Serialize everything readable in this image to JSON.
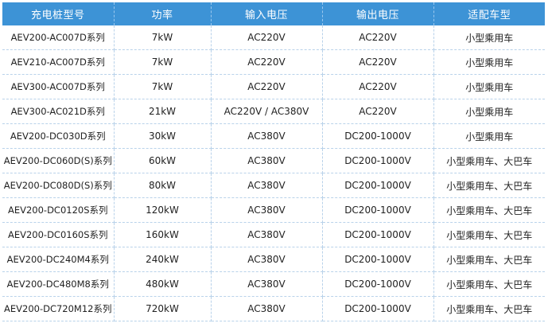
{
  "table": {
    "headers": [
      "充电桩型号",
      "功率",
      "输入电压",
      "输出电压",
      "适配车型"
    ],
    "rows": [
      [
        "AEV200-AC007D系列",
        "7kW",
        "AC220V",
        "AC220V",
        "小型乘用车"
      ],
      [
        "AEV210-AC007D系列",
        "7kW",
        "AC220V",
        "AC220V",
        "小型乘用车"
      ],
      [
        "AEV300-AC007D系列",
        "7kW",
        "AC220V",
        "AC220V",
        "小型乘用车"
      ],
      [
        "AEV300-AC021D系列",
        "21kW",
        "AC220V / AC380V",
        "AC220V",
        "小型乘用车"
      ],
      [
        "AEV200-DC030D系列",
        "30kW",
        "AC380V",
        "DC200-1000V",
        "小型乘用车"
      ],
      [
        "AEV200-DC060D(S)系列",
        "60kW",
        "AC380V",
        "DC200-1000V",
        "小型乘用车、大巴车"
      ],
      [
        "AEV200-DC080D(S)系列",
        "80kW",
        "AC380V",
        "DC200-1000V",
        "小型乘用车、大巴车"
      ],
      [
        "AEV200-DC0120S系列",
        "120kW",
        "AC380V",
        "DC200-1000V",
        "小型乘用车、大巴车"
      ],
      [
        "AEV200-DC0160S系列",
        "160kW",
        "AC380V",
        "DC200-1000V",
        "小型乘用车、大巴车"
      ],
      [
        "AEV200-DC240M4系列",
        "240kW",
        "AC380V",
        "DC200-1000V",
        "小型乘用车、大巴车"
      ],
      [
        "AEV200-DC480M8系列",
        "480kW",
        "AC380V",
        "DC200-1000V",
        "小型乘用车、大巴车"
      ],
      [
        "AEV200-DC720M12系列",
        "720kW",
        "AC380V",
        "DC200-1000V",
        "小型乘用车、大巴车"
      ]
    ]
  },
  "colors": {
    "header_bg": "#3d93d6",
    "header_text": "#ffffff",
    "grid_line": "#b9d2ea"
  }
}
